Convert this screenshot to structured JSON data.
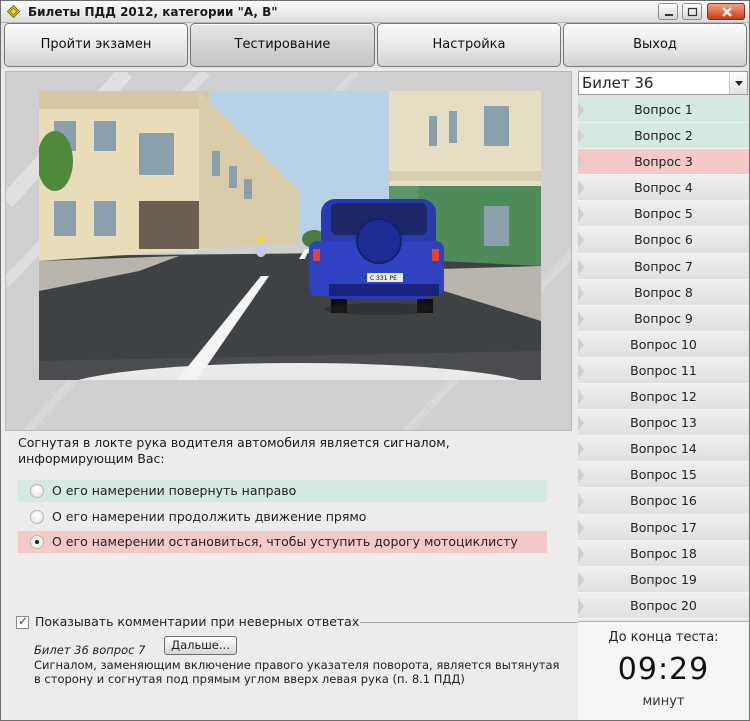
{
  "window": {
    "title": "Билеты ПДД 2012, категории \"A, B\""
  },
  "toolbar": {
    "exam_label": "Пройти экзамен",
    "testing_label": "Тестирование",
    "settings_label": "Настройка",
    "exit_label": "Выход"
  },
  "scene": {
    "license_plate": "С 331 РЕ"
  },
  "question": {
    "text_line1": "Согнутая в локте рука водителя автомобиля является сигналом,",
    "text_line2": "информирующим Вас:",
    "answers": [
      {
        "label": "О его намерении повернуть направо",
        "state": "correct",
        "selected": false
      },
      {
        "label": "О его намерении продолжить движение прямо",
        "state": "none",
        "selected": false
      },
      {
        "label": "О его намерении остановиться, чтобы уступить дорогу мотоциклисту",
        "state": "wrong",
        "selected": true
      }
    ]
  },
  "comments": {
    "checkbox_label": "Показывать комментарии при неверных ответах",
    "checked": true,
    "reference": "Билет 36 вопрос 7",
    "next_label": "Дальше...",
    "text_line1": "Сигналом, заменяющим включение правого указателя поворота, является вытянутая",
    "text_line2": "в сторону и согнутая под прямым углом вверх левая рука (п. 8.1 ПДД)"
  },
  "sidebar": {
    "ticket": "Билет 36",
    "questions": [
      {
        "label": "Вопрос 1",
        "state": "correct"
      },
      {
        "label": "Вопрос 2",
        "state": "correct"
      },
      {
        "label": "Вопрос 3",
        "state": "wrong"
      },
      {
        "label": "Вопрос 4",
        "state": "none"
      },
      {
        "label": "Вопрос 5",
        "state": "none"
      },
      {
        "label": "Вопрос 6",
        "state": "none"
      },
      {
        "label": "Вопрос 7",
        "state": "none"
      },
      {
        "label": "Вопрос 8",
        "state": "none"
      },
      {
        "label": "Вопрос 9",
        "state": "none"
      },
      {
        "label": "Вопрос 10",
        "state": "none"
      },
      {
        "label": "Вопрос 11",
        "state": "none"
      },
      {
        "label": "Вопрос 12",
        "state": "none"
      },
      {
        "label": "Вопрос 13",
        "state": "none"
      },
      {
        "label": "Вопрос 14",
        "state": "none"
      },
      {
        "label": "Вопрос 15",
        "state": "none"
      },
      {
        "label": "Вопрос 16",
        "state": "none"
      },
      {
        "label": "Вопрос 17",
        "state": "none"
      },
      {
        "label": "Вопрос 18",
        "state": "none"
      },
      {
        "label": "Вопрос 19",
        "state": "none"
      },
      {
        "label": "Вопрос 20",
        "state": "none"
      }
    ]
  },
  "timer": {
    "label": "До конца теста:",
    "value": "09:29",
    "unit": "минут"
  },
  "colors": {
    "correct_bg": "#d4e9df",
    "wrong_bg": "#f6c9c9"
  }
}
